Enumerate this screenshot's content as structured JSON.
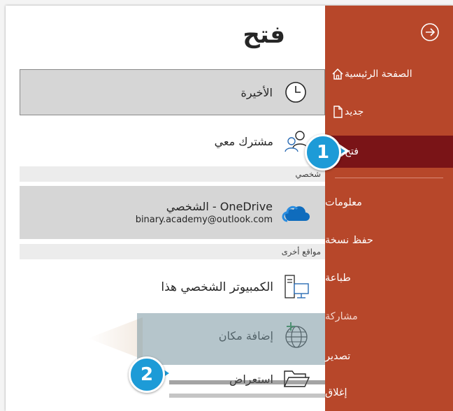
{
  "page": {
    "title": "فتح"
  },
  "nav": {
    "items": [
      {
        "label": "الصفحة الرئيسية",
        "icon": "home-icon"
      },
      {
        "label": "جديد",
        "icon": "new-document-icon"
      },
      {
        "label": "فتح",
        "icon": "open-folder-icon",
        "active": true
      },
      {
        "label": "معلومات"
      },
      {
        "label": "حفظ نسخة"
      },
      {
        "label": "طباعة"
      },
      {
        "label": "مشاركة"
      },
      {
        "label": "تصدير"
      },
      {
        "label": "إغلاق"
      }
    ],
    "back_icon": "back-arrow-icon"
  },
  "locations": {
    "recent": {
      "label": "الأخيرة",
      "icon": "clock-icon"
    },
    "shared": {
      "label": "مشترك معي",
      "icon": "shared-users-icon"
    },
    "personal_section": "شخصي",
    "onedrive": {
      "label": "OneDrive - الشخصي",
      "account": "binary.academy@outlook.com",
      "icon": "onedrive-cloud-icon"
    },
    "other_section": "مواقع أخرى",
    "this_pc": {
      "label": "الكمبيوتر الشخصي هذا",
      "icon": "computer-icon"
    },
    "add_place": {
      "label": "إضافة مكان",
      "icon": "globe-add-icon"
    },
    "browse": {
      "label": "استعراض",
      "icon": "folder-icon"
    }
  },
  "badges": {
    "step1": "1",
    "step2": "2"
  },
  "colors": {
    "nav_background": "#b7472a",
    "nav_active": "#7a1417",
    "badge": "#1d9bd7"
  }
}
